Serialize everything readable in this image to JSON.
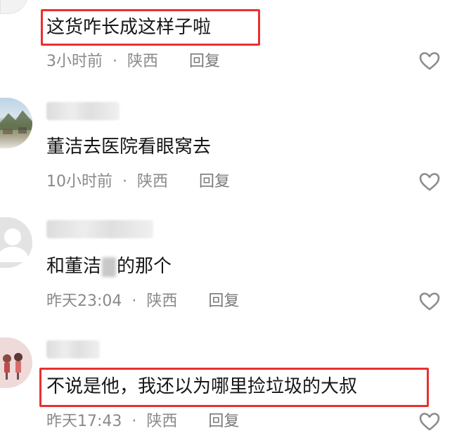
{
  "comments": [
    {
      "text": "这货咋长成这样子啦",
      "time": "3小时前",
      "sep": "·",
      "location": "陕西",
      "reply": "回复"
    },
    {
      "username": "",
      "text": "董洁去医院看眼窝去",
      "time": "10小时前",
      "sep": "·",
      "location": "陕西",
      "reply": "回复"
    },
    {
      "username": "",
      "text_before": "和董洁",
      "text_after": "的那个",
      "time": "昨天23:04",
      "sep": "·",
      "location": "陕西",
      "reply": "回复"
    },
    {
      "username": "",
      "text": "不说是他，我还以为哪里捡垃圾的大叔",
      "time": "昨天17:43",
      "sep": "·",
      "location": "陕西",
      "reply": "回复"
    }
  ],
  "icons": {
    "like": "heart-outline-icon"
  },
  "colors": {
    "highlight_box": "#e8312f",
    "meta_text": "#8a8a8a",
    "body_text": "#161616"
  }
}
